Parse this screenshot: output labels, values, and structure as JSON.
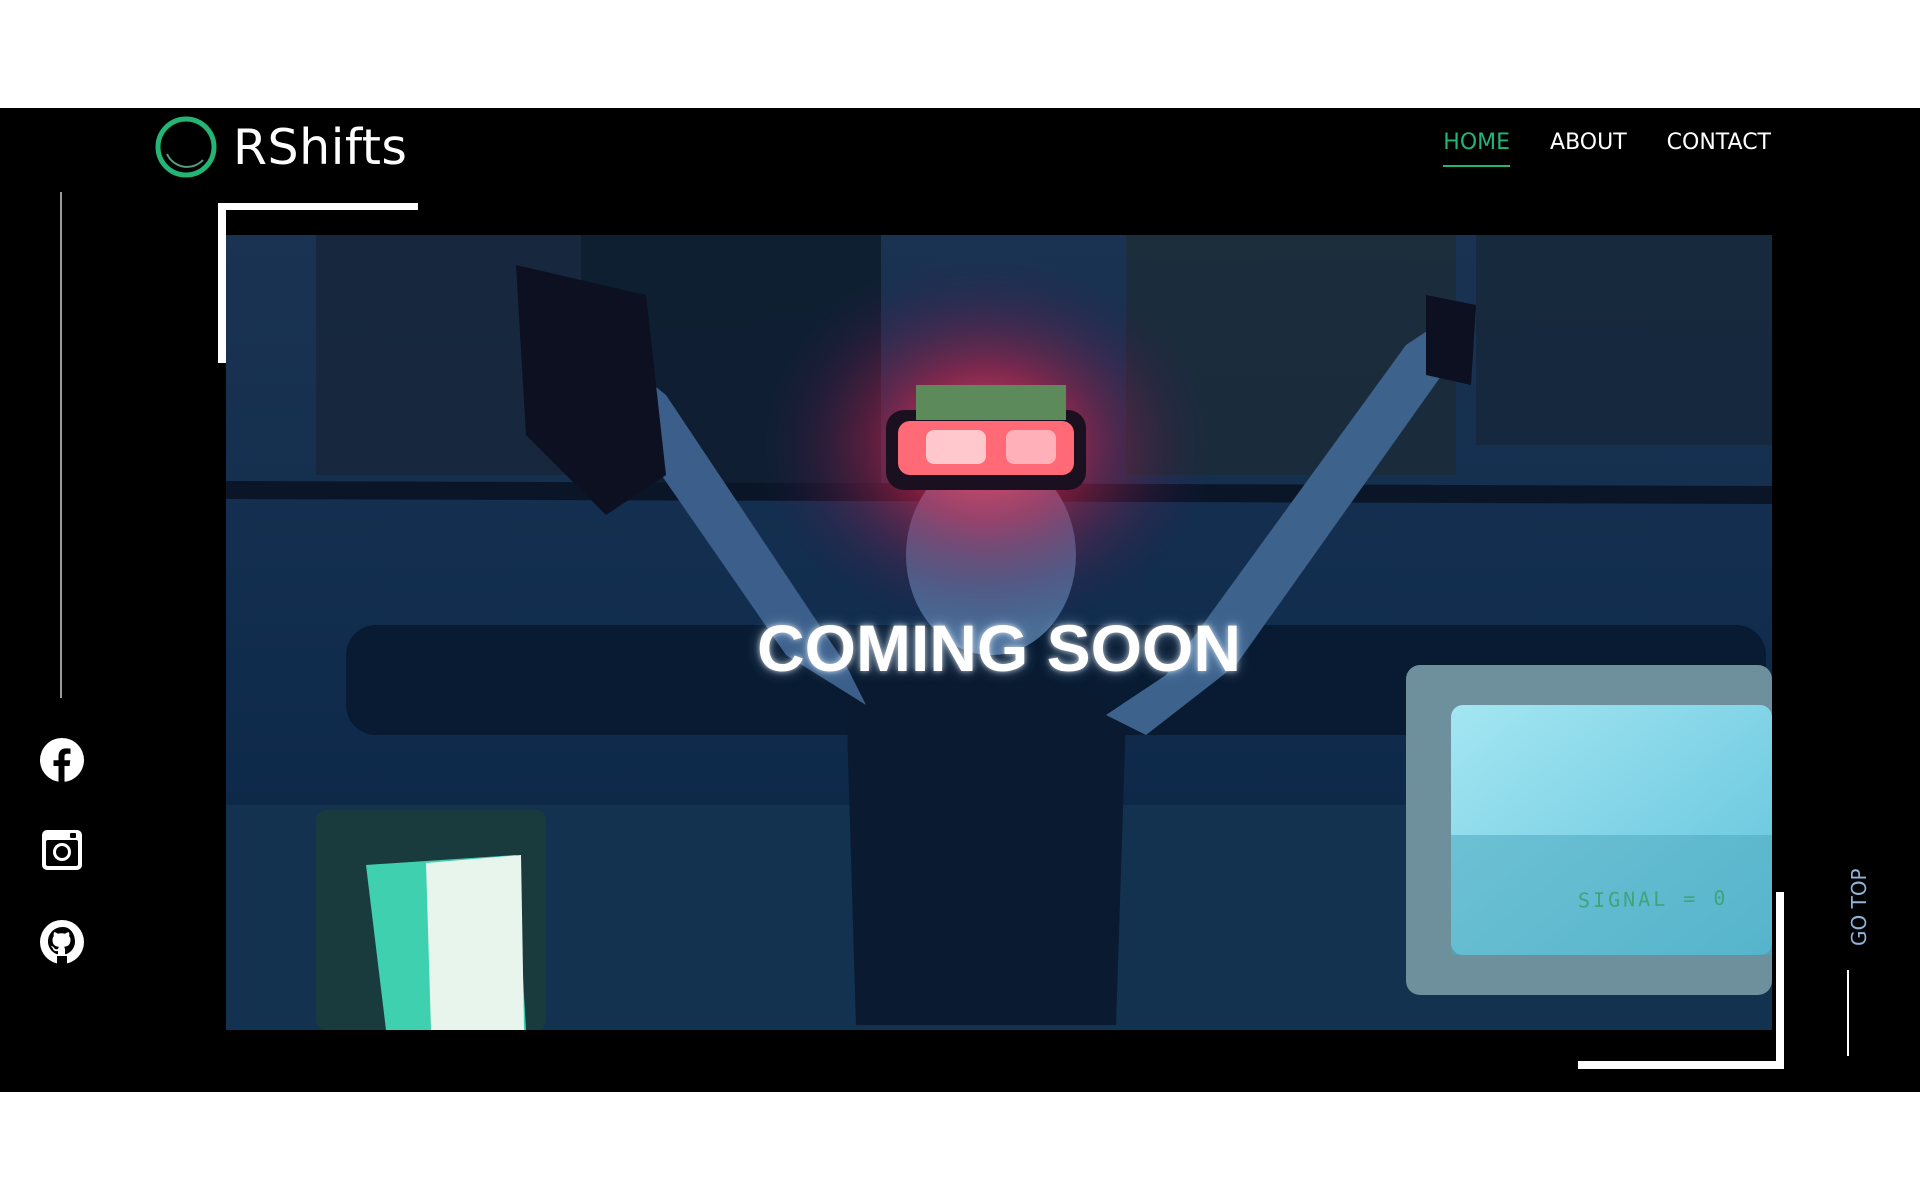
{
  "brand": {
    "name": "RShifts",
    "accent_color": "#22b574"
  },
  "nav": {
    "items": [
      {
        "label": "HOME",
        "active": true
      },
      {
        "label": "ABOUT",
        "active": false
      },
      {
        "label": "CONTACT",
        "active": false
      }
    ]
  },
  "social": [
    {
      "icon": "facebook-icon"
    },
    {
      "icon": "instagram-icon"
    },
    {
      "icon": "github-icon"
    }
  ],
  "hero": {
    "title": "COMING SOON",
    "screen_text": "SIGNAL = 0",
    "background": "video still: person wearing glowing red VR headset with raised arms, CRT monitors"
  },
  "go_top": {
    "label": "GO TOP"
  }
}
